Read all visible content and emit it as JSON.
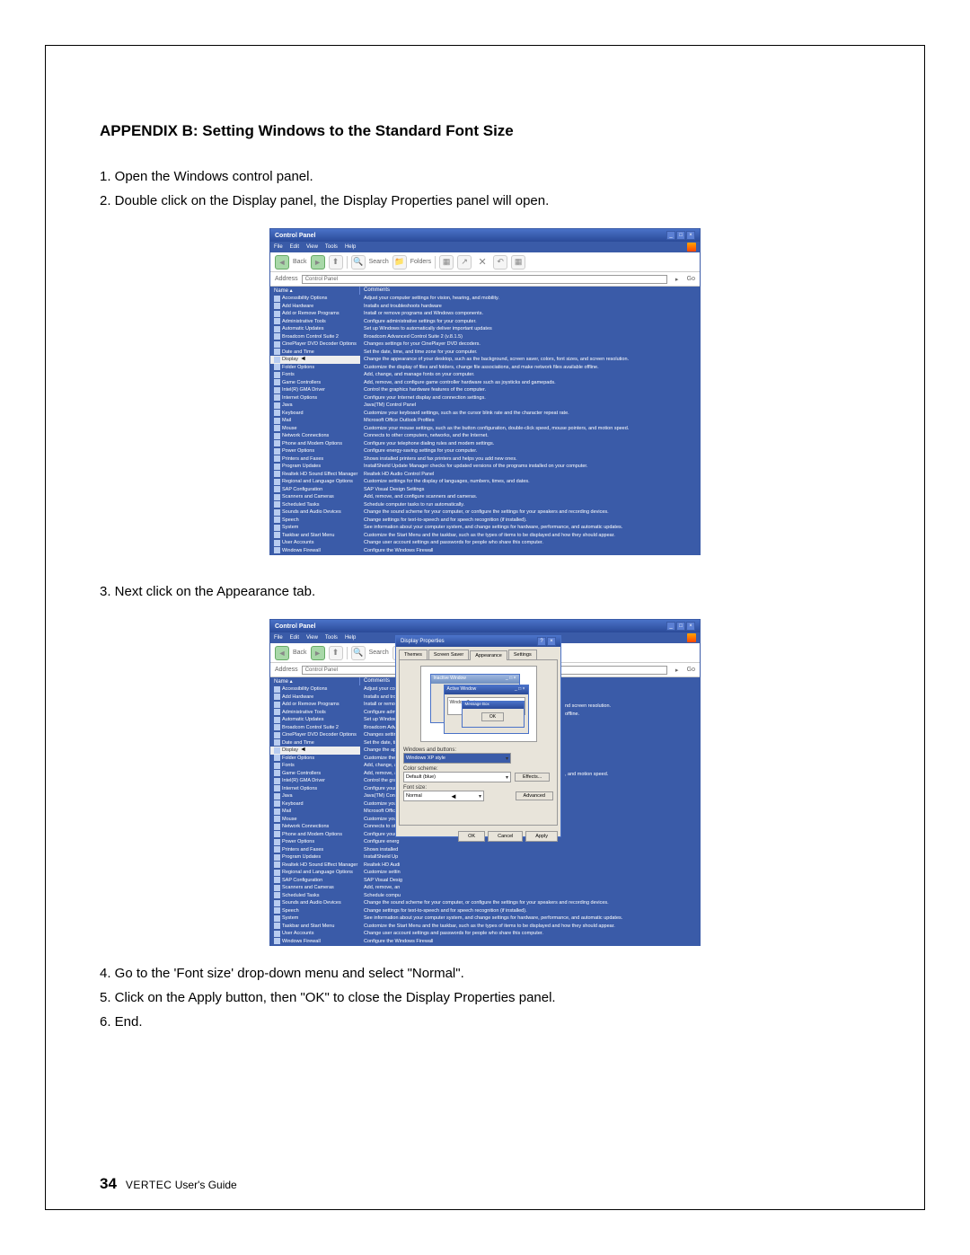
{
  "heading": "APPENDIX B: Setting Windows to the Standard Font Size",
  "steps": {
    "s1": "1.  Open the Windows control panel.",
    "s2": "2.  Double click on the Display panel, the Display Properties panel will open.",
    "s3": "3.  Next  click on the Appearance tab.",
    "s4": "4.  Go to the 'Font size' drop-down menu and select \"Normal\".",
    "s5": "5.  Click on the Apply button, then \"OK\" to close the Display Properties panel.",
    "s6": "6.  End."
  },
  "cp": {
    "title": "Control Panel",
    "menu": {
      "file": "File",
      "edit": "Edit",
      "view": "View",
      "tools": "Tools",
      "help": "Help"
    },
    "toolbar": {
      "back": "Back",
      "search": "Search",
      "folders": "Folders"
    },
    "address_label": "Address",
    "address_value": "Control Panel",
    "go": "Go",
    "col_name": "Name",
    "col_comments": "Comments",
    "items": [
      {
        "n": "Accessibility Options",
        "d": "Adjust your computer settings for vision, hearing, and mobility."
      },
      {
        "n": "Add Hardware",
        "d": "Installs and troubleshoots hardware"
      },
      {
        "n": "Add or Remove Programs",
        "d": "Install or remove programs and Windows components."
      },
      {
        "n": "Administrative Tools",
        "d": "Configure administrative settings for your computer."
      },
      {
        "n": "Automatic Updates",
        "d": "Set up Windows to automatically deliver important updates"
      },
      {
        "n": "Broadcom Control Suite 2",
        "d": "Broadcom Advanced Control Suite 2 (v.8.1.5)"
      },
      {
        "n": "CinePlayer DVD Decoder Options",
        "d": "Changes settings for your CinePlayer DVD decoders."
      },
      {
        "n": "Date and Time",
        "d": "Set the date, time, and time zone for your computer."
      },
      {
        "n": "Display",
        "d": "Change the appearance of your desktop, such as the background, screen saver, colors, font sizes, and screen resolution.",
        "hl": true
      },
      {
        "n": "Folder Options",
        "d": "Customize the display of files and folders, change file associations, and make network files available offline."
      },
      {
        "n": "Fonts",
        "d": "Add, change, and manage fonts on your computer."
      },
      {
        "n": "Game Controllers",
        "d": "Add, remove, and configure game controller hardware such as joysticks and gamepads."
      },
      {
        "n": "Intel(R) GMA Driver",
        "d": "Control the graphics hardware features of the computer."
      },
      {
        "n": "Internet Options",
        "d": "Configure your Internet display and connection settings."
      },
      {
        "n": "Java",
        "d": "Java(TM) Control Panel"
      },
      {
        "n": "Keyboard",
        "d": "Customize your keyboard settings, such as the cursor blink rate and the character repeat rate."
      },
      {
        "n": "Mail",
        "d": "Microsoft Office Outlook Profiles"
      },
      {
        "n": "Mouse",
        "d": "Customize your mouse settings, such as the button configuration, double-click speed, mouse pointers, and motion speed."
      },
      {
        "n": "Network Connections",
        "d": "Connects to other computers, networks, and the Internet."
      },
      {
        "n": "Phone and Modem Options",
        "d": "Configure your telephone dialing rules and modem settings."
      },
      {
        "n": "Power Options",
        "d": "Configure energy-saving settings for your computer."
      },
      {
        "n": "Printers and Faxes",
        "d": "Shows installed printers and fax printers and helps you add new ones."
      },
      {
        "n": "Program Updates",
        "d": "InstallShield Update Manager checks for updated versions of the programs installed on your computer."
      },
      {
        "n": "Realtek HD Sound Effect Manager",
        "d": "Realtek HD Audio Control Panel"
      },
      {
        "n": "Regional and Language Options",
        "d": "Customize settings for the display of languages, numbers, times, and dates."
      },
      {
        "n": "SAP Configuration",
        "d": "SAP Visual Design Settings"
      },
      {
        "n": "Scanners and Cameras",
        "d": "Add, remove, and configure scanners and cameras."
      },
      {
        "n": "Scheduled Tasks",
        "d": "Schedule computer tasks to run automatically."
      },
      {
        "n": "Sounds and Audio Devices",
        "d": "Change the sound scheme for your computer, or configure the settings for your speakers and recording devices."
      },
      {
        "n": "Speech",
        "d": "Change settings for text-to-speech and for speech recognition (if installed)."
      },
      {
        "n": "System",
        "d": "See information about your computer system, and change settings for hardware, performance, and automatic updates."
      },
      {
        "n": "Taskbar and Start Menu",
        "d": "Customize the Start Menu and the taskbar, such as the types of items to be displayed and how they should appear."
      },
      {
        "n": "User Accounts",
        "d": "Change user account settings and passwords for people who share this computer."
      },
      {
        "n": "Windows Firewall",
        "d": "Configure the Windows Firewall"
      }
    ],
    "items_trunc": [
      {
        "n": "Accessibility Options",
        "d": "Adjust your com"
      },
      {
        "n": "Add Hardware",
        "d": "Installs and trou"
      },
      {
        "n": "Add or Remove Programs",
        "d": "Install or remove"
      },
      {
        "n": "Administrative Tools",
        "d": "Configure admin"
      },
      {
        "n": "Automatic Updates",
        "d": "Set up Windows"
      },
      {
        "n": "Broadcom Control Suite 2",
        "d": "Broadcom Advan"
      },
      {
        "n": "CinePlayer DVD Decoder Options",
        "d": "Changes setting"
      },
      {
        "n": "Date and Time",
        "d": "Set the date, tim"
      },
      {
        "n": "Display",
        "d": "Change the appe",
        "hl": true
      },
      {
        "n": "Folder Options",
        "d": "Customize the di"
      },
      {
        "n": "Fonts",
        "d": "Add, change, an"
      },
      {
        "n": "Game Controllers",
        "d": "Add, remove, an"
      },
      {
        "n": "Intel(R) GMA Driver",
        "d": "Control the grap"
      },
      {
        "n": "Internet Options",
        "d": "Configure your I"
      },
      {
        "n": "Java",
        "d": "Java(TM) Contro"
      },
      {
        "n": "Keyboard",
        "d": "Customize your"
      },
      {
        "n": "Mail",
        "d": "Microsoft Office"
      },
      {
        "n": "Mouse",
        "d": "Customize your"
      },
      {
        "n": "Network Connections",
        "d": "Connects to othe"
      },
      {
        "n": "Phone and Modem Options",
        "d": "Configure your t"
      },
      {
        "n": "Power Options",
        "d": "Configure energ"
      },
      {
        "n": "Printers and Faxes",
        "d": "Shows installed"
      },
      {
        "n": "Program Updates",
        "d": "InstallShield Up"
      },
      {
        "n": "Realtek HD Sound Effect Manager",
        "d": "Realtek HD Audi"
      },
      {
        "n": "Regional and Language Options",
        "d": "Customize settin"
      },
      {
        "n": "SAP Configuration",
        "d": "SAP Visual Desig"
      },
      {
        "n": "Scanners and Cameras",
        "d": "Add, remove, an"
      },
      {
        "n": "Scheduled Tasks",
        "d": "Schedule compu"
      },
      {
        "n": "Sounds and Audio Devices",
        "d": "Change the sound scheme for your computer, or configure the settings for your speakers and recording devices."
      },
      {
        "n": "Speech",
        "d": "Change settings for text-to-speech and for speech recognition (if installed)."
      },
      {
        "n": "System",
        "d": "See information about your computer system, and change settings for hardware, performance, and automatic updates."
      },
      {
        "n": "Taskbar and Start Menu",
        "d": "Customize the Start Menu and the taskbar, such as the types of items to be displayed and how they should appear."
      },
      {
        "n": "User Accounts",
        "d": "Change user account settings and passwords for people who share this computer."
      },
      {
        "n": "Windows Firewall",
        "d": "Configure the Windows Firewall"
      }
    ],
    "tail": [
      "nd screen resolution.",
      "offline.",
      ", and motion speed."
    ]
  },
  "dp": {
    "title": "Display Properties",
    "tabs": {
      "t1": "Themes",
      "t2": "Screen Saver",
      "t3": "Appearance",
      "t4": "Settings"
    },
    "preview": {
      "inactive": "Inactive Window",
      "active": "Active Window",
      "wintext": "Window Text",
      "msgbox": "Message Box",
      "ok": "OK"
    },
    "label_style": "Windows and buttons:",
    "style_value": "Windows XP style",
    "label_scheme": "Color scheme:",
    "scheme_value": "Default (blue)",
    "label_fontsize": "Font size:",
    "fontsize_value": "Normal",
    "btn_effects": "Effects...",
    "btn_advanced": "Advanced",
    "btn_ok": "OK",
    "btn_cancel": "Cancel",
    "btn_apply": "Apply"
  },
  "footer": {
    "page": "34",
    "brand": "VERTEC",
    "guide": "User's Guide"
  }
}
